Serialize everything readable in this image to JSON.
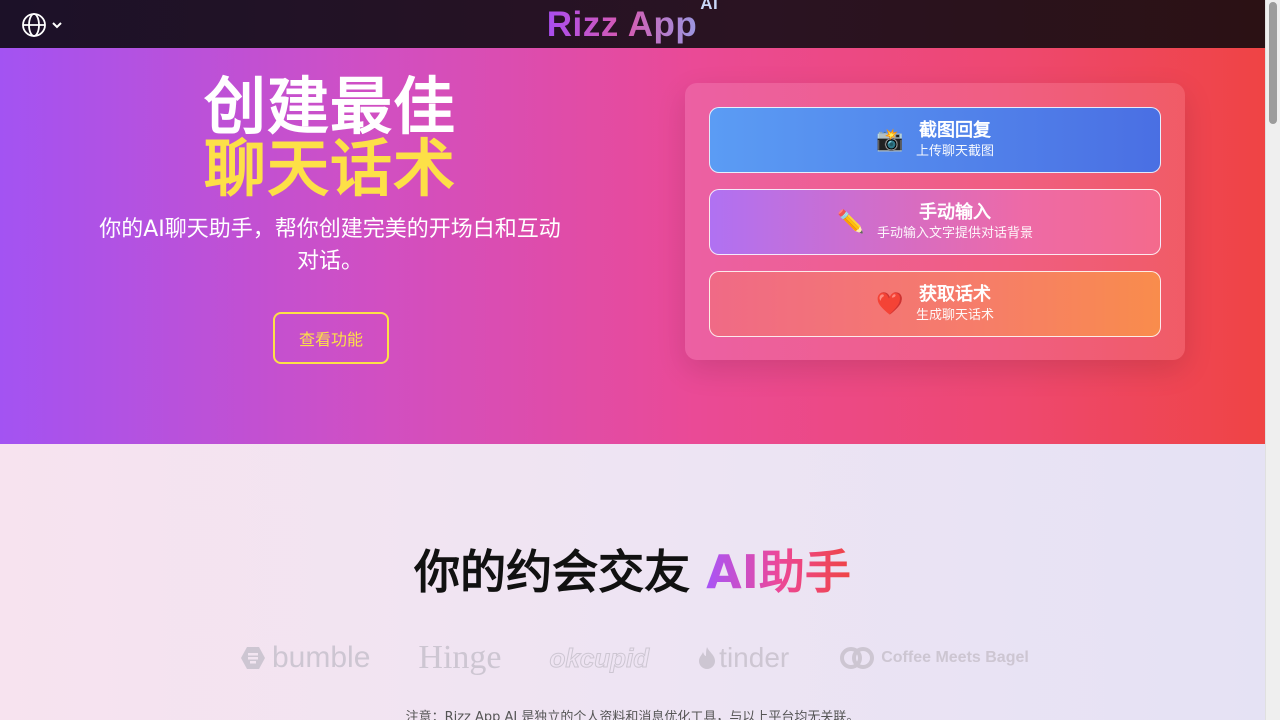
{
  "header": {
    "logo_text": "Rizz App",
    "logo_sup": "AI",
    "language_icon": "globe-icon",
    "language_chevron": "chevron-down-icon"
  },
  "hero": {
    "title_line1": "创建最佳",
    "title_line2": "聊天话术",
    "subtitle": "你的AI聊天助手，帮你创建完美的开场白和互动对话。",
    "cta_label": "查看功能",
    "options": [
      {
        "icon": "camera-icon",
        "glyph": "📸",
        "title": "截图回复",
        "desc": "上传聊天截图"
      },
      {
        "icon": "pencil-icon",
        "glyph": "✏️",
        "title": "手动输入",
        "desc": "手动输入文字提供对话背景"
      },
      {
        "icon": "heart-icon",
        "glyph": "❤️",
        "title": "获取话术",
        "desc": "生成聊天话术"
      }
    ]
  },
  "section2": {
    "title_plain": "你的约会交友 ",
    "title_accent": "AI助手",
    "brands": [
      "bumble",
      "Hinge",
      "okcupid",
      "tinder",
      "Coffee Meets Bagel"
    ],
    "note": "注意：Rizz App AI 是独立的个人资料和消息优化工具，与以上平台均无关联。"
  },
  "colors": {
    "title_yellow": "#fde047",
    "hero_start": "#a353f2",
    "hero_end": "#ef4444"
  }
}
